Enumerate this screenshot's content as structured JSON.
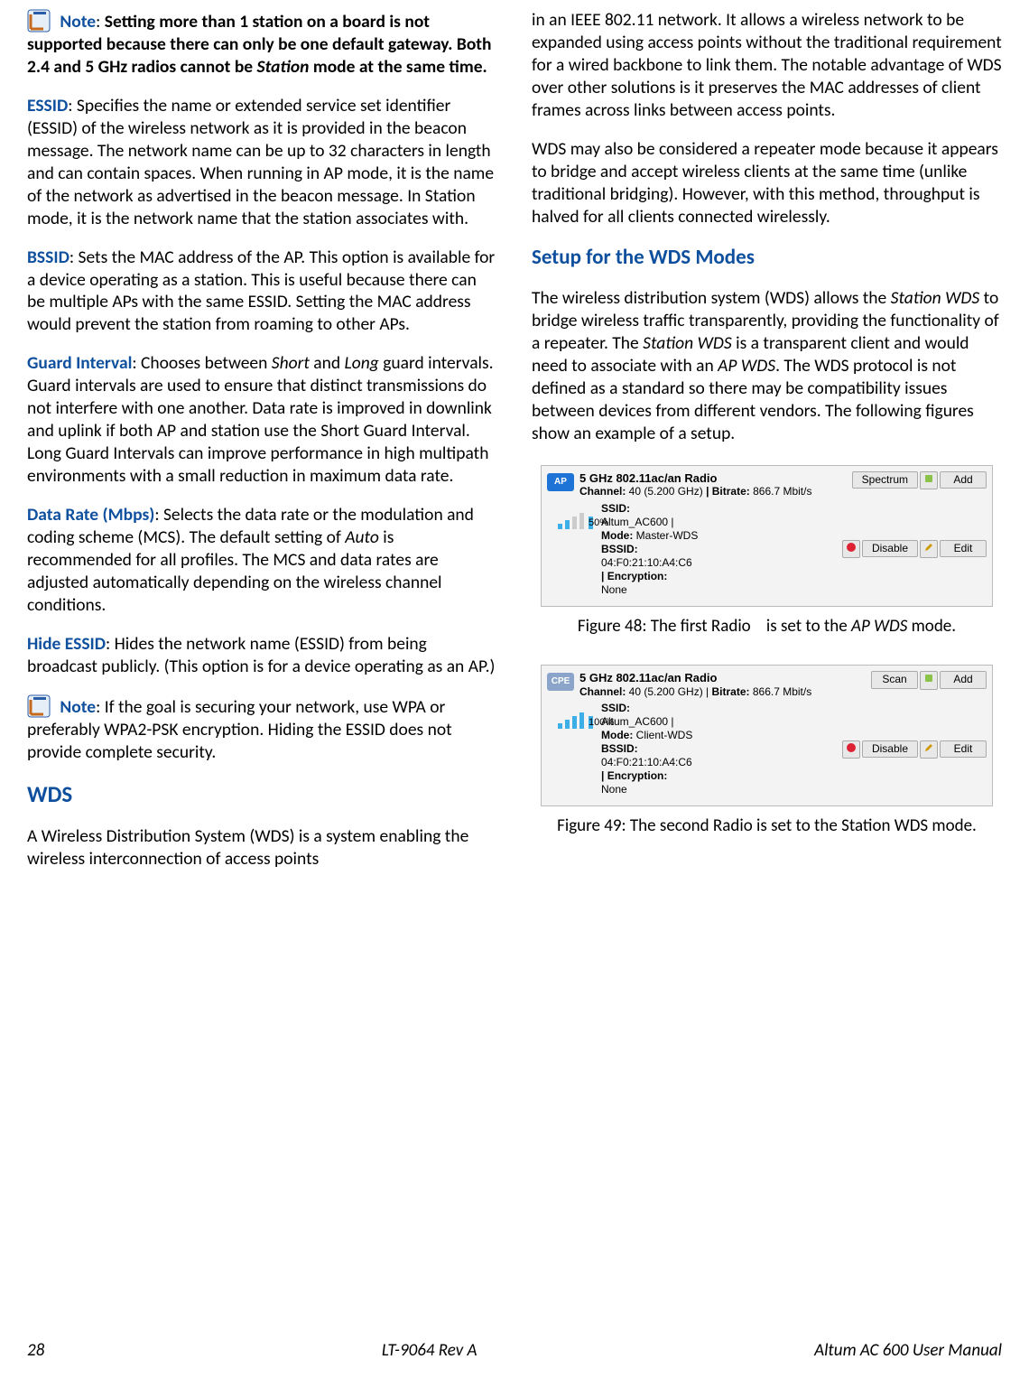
{
  "col1": {
    "note1": {
      "label": "Note",
      "text": "Setting more than 1 station on a board is not supported because there can only be one default gateway. Both 2.4 and 5 GHz radios cannot be ",
      "text2": "mode at the same time.",
      "italic": "Station"
    },
    "essid": {
      "term": "ESSID",
      "body": ": Specifies the name or extended service set identifier (ESSID) of the wireless network as it is provided in the beacon message. The network name can be up to 32 characters in length and can contain spaces. When running in AP mode, it is the name of the network as advertised in the beacon message. In Station mode, it is the network name that the station associates with."
    },
    "bssid": {
      "term": "BSSID",
      "body": ": Sets the MAC address of the AP. This option is available for a device operating as a station. This is useful because there can be multiple APs with the same ESSID. Setting the MAC address would prevent the station from roaming to other APs."
    },
    "guard": {
      "term": "Guard Interval",
      "pre": ": Chooses between ",
      "it1": "Short",
      "mid": " and ",
      "it2": "Long",
      "post": " guard intervals. Guard intervals are used to ensure that distinct transmissions do not interfere with one another. Data rate is improved in downlink and uplink if both AP and station use the Short Guard Interval. Long Guard Intervals can improve performance in high multipath environments with a small reduction in maximum data rate."
    },
    "rate": {
      "term": "Data Rate (Mbps)",
      "pre": ": Selects the data rate or the modulation and coding scheme (MCS). The default setting of ",
      "it": "Auto",
      "post": " is recommended for all profiles. The MCS and data rates are adjusted automatically depending on the wireless channel conditions."
    },
    "hide": {
      "term": "Hide ESSID",
      "body": ": Hides the network name (ESSID) from being broadcast publicly. (This option is for a device operating as an AP.)"
    },
    "note2": {
      "label": "Note",
      "body": ": If the goal is securing your network, use WPA or preferably WPA2-PSK encryption. Hiding the ESSID does not provide complete security."
    },
    "wds_h": "WDS",
    "wds_p": "A Wireless Distribution System (WDS) is a system enabling the wireless interconnection of access points "
  },
  "col2": {
    "p1": "in an IEEE 802.11 network. It allows a wireless network to be expanded using access points without the traditional requirement for a wired backbone to link them. The notable advantage of WDS over other solutions is it preserves the MAC addresses of client frames across links between access points.",
    "p2": "WDS may also be considered a repeater mode because it appears to bridge and accept wireless clients at the same time (unlike traditional bridging). However, with this method, throughput is halved for all clients connected wirelessly.",
    "h3": "Setup for the WDS Modes",
    "p3a": "The wireless distribution system (WDS) allows the ",
    "p3_it1": "Station WDS",
    "p3b": " to bridge wireless traffic transparently, providing the functionality of a repeater. The ",
    "p3_it2": "Station WDS",
    "p3c": " is a transparent client and would need to associate with an ",
    "p3_it3": "AP WDS",
    "p3d": ". The WDS protocol is not defined as a standard so there may be compatibility issues between devices from different vendors. The following figures show an example of a setup.",
    "fig48": {
      "badge": "AP",
      "hdr": "5 GHz 802.11ac/an Radio",
      "chan_l": "Channel:",
      "chan": " 40 (5.200 GHz) ",
      "br_l": "| Bitrate:",
      "br": " 866.7 Mbit/s",
      "btn_spectrum": "Spectrum",
      "btn_add": "Add",
      "signal": "50%",
      "ssid_l": "SSID:",
      "ssid": "Altum_AC600 |",
      "mode_l": "Mode:",
      "mode": " Master-WDS",
      "bssid_l": "BSSID:",
      "bssid": "04:F0:21:10:A4:C6",
      "enc_l": "| Encryption:",
      "enc": "None",
      "btn_disable": "Disable",
      "btn_edit": "Edit",
      "caption_a": "Figure 48: The first Radio ",
      "caption_b": " is set to the ",
      "caption_it": "AP WDS",
      "caption_c": " mode."
    },
    "fig49": {
      "badge": "CPE",
      "hdr": "5 GHz 802.11ac/an Radio",
      "chan_l": "Channel:",
      "chan": " 40 (5.200 GHz) | ",
      "br_l": "Bitrate:",
      "br": " 866.7 Mbit/s",
      "btn_scan": "Scan",
      "btn_add": "Add",
      "signal": "100%",
      "ssid_l": "SSID:",
      "ssid": "Altum_AC600 |",
      "mode_l": "Mode:",
      "mode": " Client-WDS",
      "bssid_l": "BSSID:",
      "bssid": "04:F0:21:10:A4:C6",
      "enc_l": "| Encryption:",
      "enc": "None",
      "btn_disable": "Disable",
      "btn_edit": "Edit",
      "caption": "Figure 49: The second Radio is set to the Station WDS mode."
    }
  },
  "footer": {
    "page": "28",
    "rev": "LT-9064 Rev A",
    "title": "Altum AC 600 User Manual"
  }
}
